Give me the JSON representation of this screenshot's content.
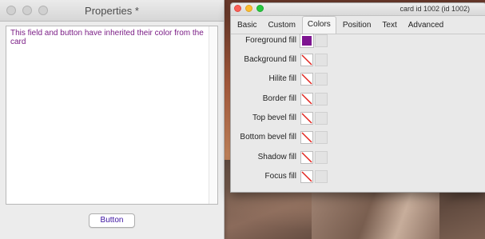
{
  "properties_window": {
    "title": "Properties *",
    "field_text": "This field and button have inherited their color from the card",
    "button_label": "Button"
  },
  "inspector_window": {
    "title": "card id 1002 (id 1002)",
    "tabs": [
      {
        "label": "Basic"
      },
      {
        "label": "Custom"
      },
      {
        "label": "Colors",
        "active": true
      },
      {
        "label": "Position"
      },
      {
        "label": "Text"
      },
      {
        "label": "Advanced"
      }
    ],
    "color_rows": [
      {
        "label": "Foreground fill",
        "swatch": "purple",
        "color": "#7e1591"
      },
      {
        "label": "Background fill",
        "swatch": "none"
      },
      {
        "label": "Hilite fill",
        "swatch": "none"
      },
      {
        "label": "Border fill",
        "swatch": "none"
      },
      {
        "label": "Top bevel fill",
        "swatch": "none"
      },
      {
        "label": "Bottom bevel fill",
        "swatch": "none"
      },
      {
        "label": "Shadow fill",
        "swatch": "none"
      },
      {
        "label": "Focus fill",
        "swatch": "none"
      }
    ]
  },
  "colors": {
    "field_text": "#7b1e86",
    "button_text": "#3a10a0",
    "none_slash": "#e0211b"
  }
}
